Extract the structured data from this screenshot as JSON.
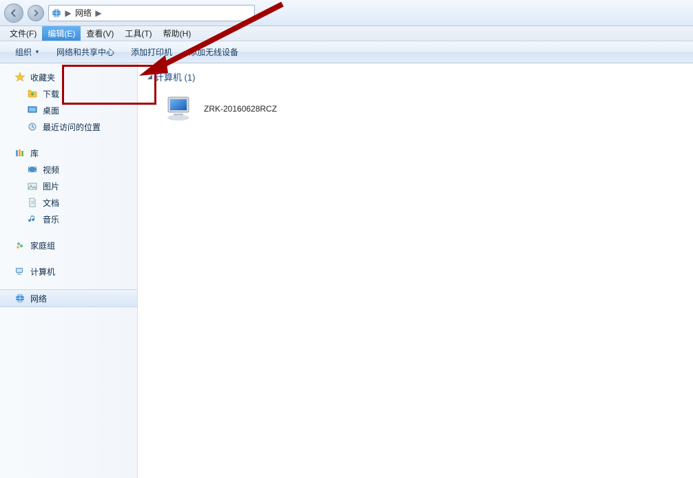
{
  "breadcrumb": {
    "root_icon": "network-icon",
    "location": "网络"
  },
  "menu": {
    "file": "文件(F)",
    "edit": "编辑(E)",
    "view": "查看(V)",
    "tools": "工具(T)",
    "help": "帮助(H)",
    "active": "edit"
  },
  "toolbar": {
    "organize": "组织",
    "network_center": "网络和共享中心",
    "add_printer": "添加打印机",
    "add_wireless": "添加无线设备"
  },
  "sidebar": {
    "favorites": {
      "label": "收藏夹",
      "items": [
        {
          "icon": "download-icon",
          "label": "下载"
        },
        {
          "icon": "desktop-icon",
          "label": "桌面"
        },
        {
          "icon": "recent-icon",
          "label": "最近访问的位置"
        }
      ]
    },
    "libraries": {
      "label": "库",
      "items": [
        {
          "icon": "video-icon",
          "label": "视频"
        },
        {
          "icon": "pictures-icon",
          "label": "图片"
        },
        {
          "icon": "documents-icon",
          "label": "文档"
        },
        {
          "icon": "music-icon",
          "label": "音乐"
        }
      ]
    },
    "homegroup": {
      "label": "家庭组"
    },
    "computer": {
      "label": "计算机"
    },
    "network": {
      "label": "网络",
      "selected": true
    }
  },
  "content": {
    "section_label": "计算机",
    "section_count": 1,
    "items": [
      {
        "name": "ZRK-20160628RCZ"
      }
    ]
  },
  "annotation": {
    "target": "network_center_toolbar_item"
  }
}
